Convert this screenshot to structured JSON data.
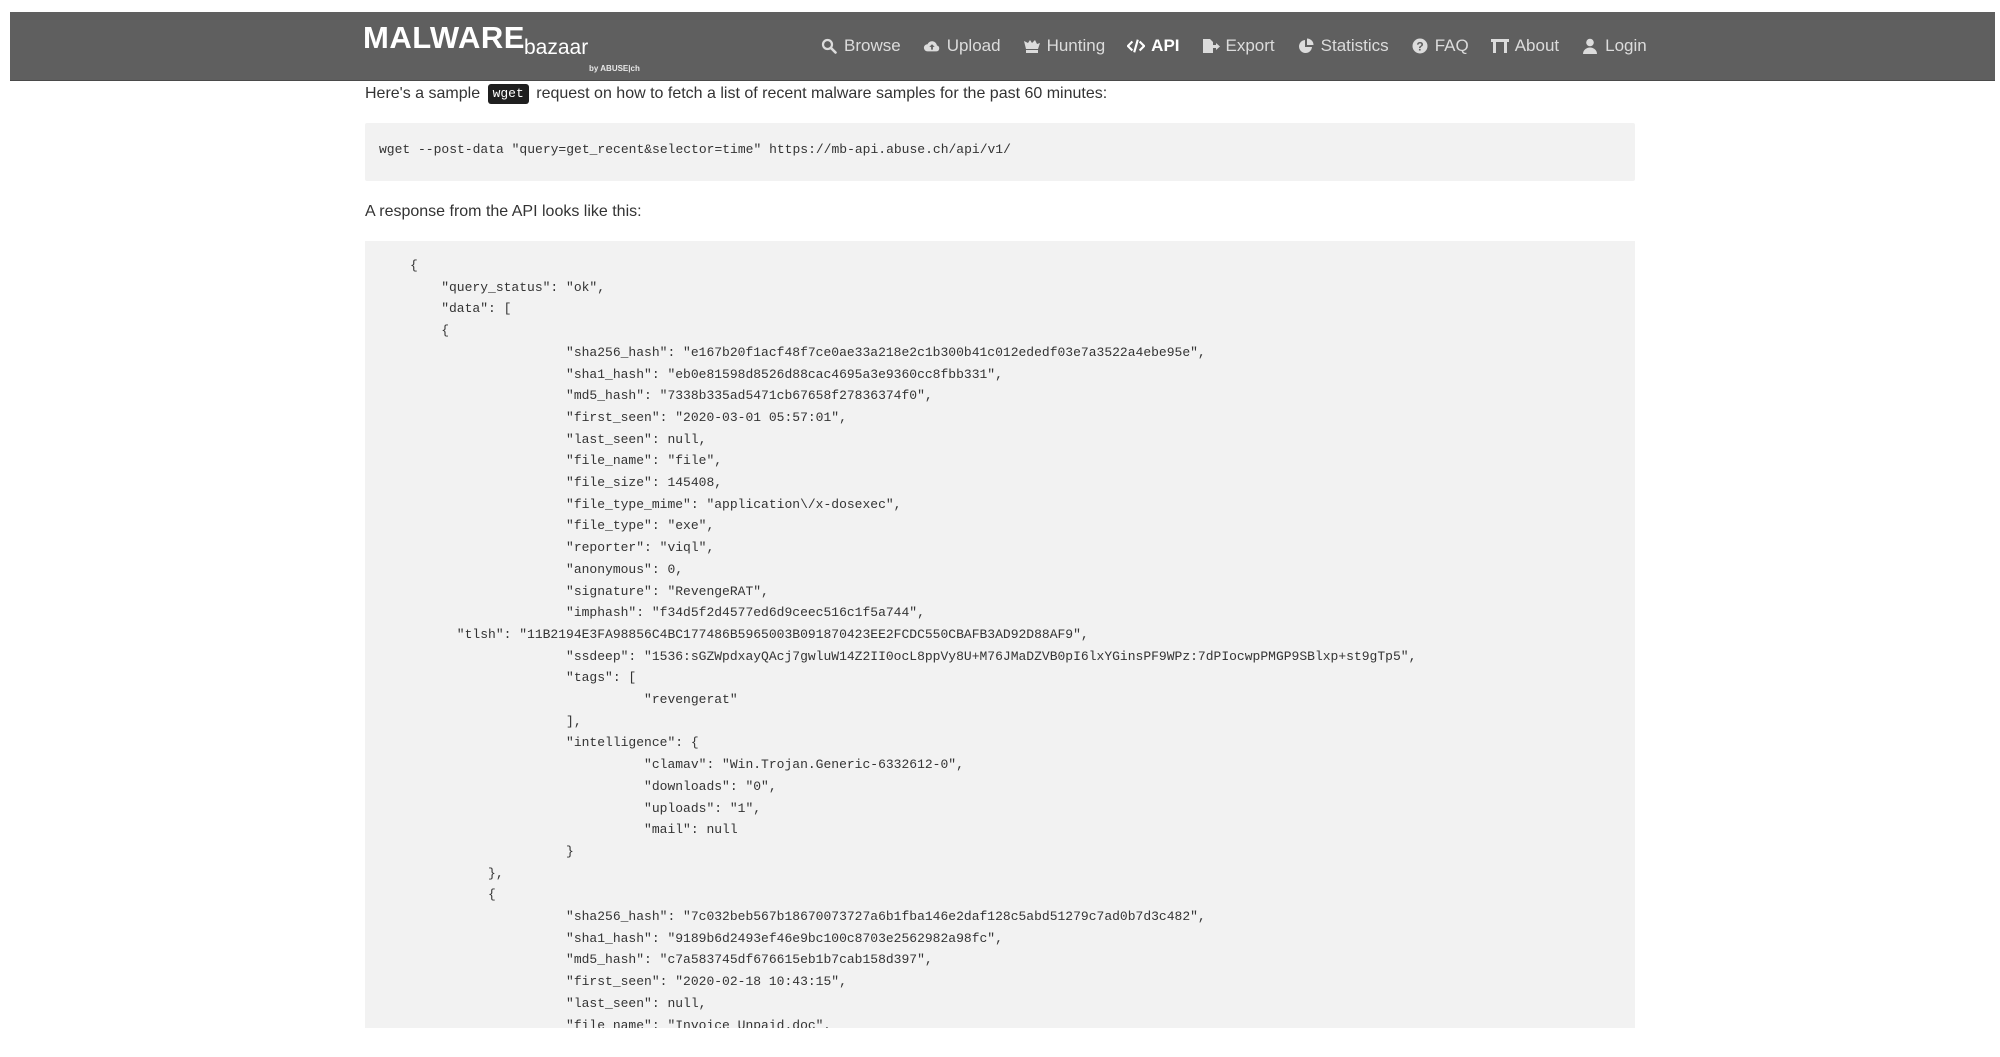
{
  "header": {
    "brand_main": "MALWARE",
    "brand_sub": "bazaar",
    "brand_by": "by ABUSE|ch",
    "nav": [
      {
        "label": "Browse",
        "icon": "search-icon"
      },
      {
        "label": "Upload",
        "icon": "cloud-upload-icon"
      },
      {
        "label": "Hunting",
        "icon": "hunting-icon"
      },
      {
        "label": "API",
        "icon": "code-icon"
      },
      {
        "label": "Export",
        "icon": "file-export-icon"
      },
      {
        "label": "Statistics",
        "icon": "pie-chart-icon"
      },
      {
        "label": "FAQ",
        "icon": "question-circle-icon"
      },
      {
        "label": "About",
        "icon": "building-icon"
      },
      {
        "label": "Login",
        "icon": "user-icon"
      }
    ],
    "active_nav": "API"
  },
  "content": {
    "intro_prefix": "Here's a sample",
    "intro_code": "wget",
    "intro_suffix": "request on how to fetch a list of recent malware samples for the past 60 minutes:",
    "command": "wget --post-data \"query=get_recent&selector=time\" https://mb-api.abuse.ch/api/v1/",
    "response_label": "A response from the API looks like this:",
    "json_lines": [
      "{",
      "    \"query_status\": \"ok\",",
      "    \"data\": [",
      "    {",
      "                    \"sha256_hash\": \"e167b20f1acf48f7ce0ae33a218e2c1b300b41c012ededf03e7a3522a4ebe95e\",",
      "                    \"sha1_hash\": \"eb0e81598d8526d88cac4695a3e9360cc8fbb331\",",
      "                    \"md5_hash\": \"7338b335ad5471cb67658f27836374f0\",",
      "                    \"first_seen\": \"2020-03-01 05:57:01\",",
      "                    \"last_seen\": null,",
      "                    \"file_name\": \"file\",",
      "                    \"file_size\": 145408,",
      "                    \"file_type_mime\": \"application\\/x-dosexec\",",
      "                    \"file_type\": \"exe\",",
      "                    \"reporter\": \"viql\",",
      "                    \"anonymous\": 0,",
      "                    \"signature\": \"RevengeRAT\",",
      "                    \"imphash\": \"f34d5f2d4577ed6d9ceec516c1f5a744\",",
      "      \"tlsh\": \"11B2194E3FA98856C4BC177486B5965003B091870423EE2FCDC550CBAFB3AD92D88AF9\",",
      "                    \"ssdeep\": \"1536:sGZWpdxayQAcj7gwluW14Z2II0ocL8ppVy8U+M76JMaDZVB0pI6lxYGinsPF9WPz:7dPIocwpPMGP9SBlxp+st9gTp5\",",
      "                    \"tags\": [",
      "                              \"revengerat\"",
      "                    ],",
      "                    \"intelligence\": {",
      "                              \"clamav\": \"Win.Trojan.Generic-6332612-0\",",
      "                              \"downloads\": \"0\",",
      "                              \"uploads\": \"1\",",
      "                              \"mail\": null",
      "                    }",
      "          },",
      "          {",
      "                    \"sha256_hash\": \"7c032beb567b18670073727a6b1fba146e2daf128c5abd51279c7ad0b7d3c482\",",
      "                    \"sha1_hash\": \"9189b6d2493ef46e9bc100c8703e2562982a98fc\",",
      "                    \"md5_hash\": \"c7a583745df676615eb1b7cab158d397\",",
      "                    \"first_seen\": \"2020-02-18 10:43:15\",",
      "                    \"last_seen\": null,",
      "                    \"file_name\": \"Invoice_Unpaid.doc\","
    ]
  }
}
